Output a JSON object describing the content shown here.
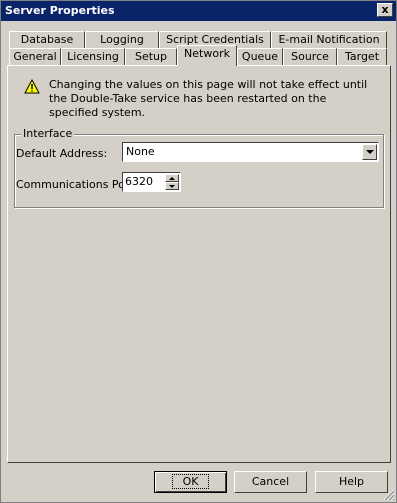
{
  "window": {
    "title": "Server Properties",
    "close_label": "x"
  },
  "tabs_top": [
    {
      "label": "Database"
    },
    {
      "label": "Logging"
    },
    {
      "label": "Script Credentials"
    },
    {
      "label": "E-mail Notification"
    }
  ],
  "tabs_bottom": [
    {
      "label": "General"
    },
    {
      "label": "Licensing"
    },
    {
      "label": "Setup"
    },
    {
      "label": "Network",
      "active": true
    },
    {
      "label": "Queue"
    },
    {
      "label": "Source"
    },
    {
      "label": "Target"
    }
  ],
  "notice": {
    "icon": "warning-icon",
    "text": "Changing the values on this page will not take effect until the Double-Take service has been restarted on the specified system."
  },
  "interface_group": {
    "title": "Interface",
    "default_address_label": "Default Address:",
    "default_address_value": "None",
    "comm_port_label": "Communications Port:",
    "comm_port_value": "6320"
  },
  "buttons": {
    "ok": "OK",
    "cancel": "Cancel",
    "help": "Help"
  }
}
